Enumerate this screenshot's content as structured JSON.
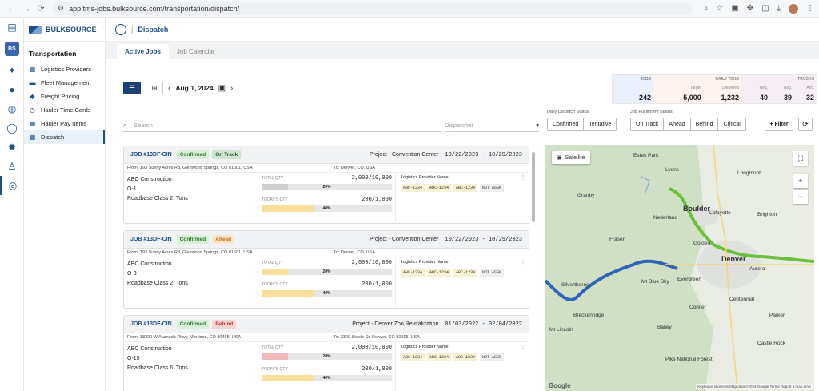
{
  "browser": {
    "url": "app.tms-jobs.bulksource.com/transportation/dispatch/"
  },
  "rail": {
    "badge": "BS"
  },
  "brand": {
    "name": "BULKSOURCE"
  },
  "nav": {
    "section": "Transportation",
    "items": [
      {
        "label": "Logistics Providers"
      },
      {
        "label": "Fleet Management"
      },
      {
        "label": "Freight Pricing"
      },
      {
        "label": "Hauler Time Cards"
      },
      {
        "label": "Hauler Pay Items"
      },
      {
        "label": "Dispatch"
      }
    ]
  },
  "page": {
    "title": "Dispatch"
  },
  "tabs": [
    {
      "label": "Active Jobs"
    },
    {
      "label": "Job Calendar"
    }
  ],
  "toolbar": {
    "date": "Aug 1, 2024"
  },
  "kpi": {
    "jobs_label": "JOBS",
    "jobs": "242",
    "tons_label": "DAILY TONS",
    "target_label": "Target",
    "target": "5,000",
    "delivered_label": "Delivered",
    "delivered": "1,232",
    "trucks_label": "TRUCKS",
    "req_label": "Req.",
    "req": "40",
    "asg_label": "Asg.",
    "asg": "39",
    "acc_label": "Acc.",
    "acc": "32"
  },
  "filters": {
    "search_placeholder": "Search",
    "dispatcher_placeholder": "Dispatcher",
    "daily_label": "Daily Dispatch Status",
    "daily": [
      "Confirmed",
      "Tentative"
    ],
    "fulfill_label": "Job Fulfillment Status",
    "fulfill": [
      "On Track",
      "Ahead",
      "Behind",
      "Critical"
    ],
    "filter_label": "+ Filter"
  },
  "jobs": [
    {
      "id": "JOB #13DF-CIN",
      "status": "Confirmed",
      "track": "On Track",
      "project": "Project - Convention Center",
      "dates": "10/22/2023 - 10/29/2023",
      "from": "From: 193 Sunny Acres Rd, Glenwood Springs, CO 81601, USA",
      "to": "To: Denver, CO, USA",
      "customer": "ABC Construction",
      "order": "O-1",
      "material": "Roadbase Class 2, Tons",
      "total_label": "TOTAL QTY",
      "total": "2,000/10,000",
      "total_pct": "20%",
      "today_label": "TODAY'S QTY",
      "today": "200/1,000",
      "today_pct": "40%",
      "lp_label": "Logistics Provider Name",
      "tags": [
        "ABC-1234",
        "ABC-1234",
        "ABC-1234",
        "NOT ASGN"
      ]
    },
    {
      "id": "JOB #13DF-CIN",
      "status": "Confirmed",
      "track": "Ahead",
      "project": "Project - Convention Center",
      "dates": "10/22/2023 - 10/29/2023",
      "from": "From: 193 Sunny Acres Rd, Glenwood Springs, CO 81601, USA",
      "to": "To: Denver, CO, USA",
      "customer": "ABC Construction",
      "order": "O-3",
      "material": "Roadbase Class 2, Tons",
      "total_label": "TOTAL QTY",
      "total": "2,000/10,000",
      "total_pct": "20%",
      "today_label": "TODAY'S QTY",
      "today": "200/1,000",
      "today_pct": "40%",
      "lp_label": "Logistics Provider Name",
      "tags": [
        "ABC-1234",
        "ABC-1234",
        "ABC-1234",
        "NOT ASGN"
      ]
    },
    {
      "id": "JOB #13DF-CIN",
      "status": "Confirmed",
      "track": "Behind",
      "project": "Project - Denver Zoo Revitalization",
      "dates": "01/03/2022 - 02/04/2022",
      "from": "From: 18300 W Alameda Pkwy, Morrison, CO 80465, USA",
      "to": "To: 2300 Steele St, Denver, CO 80205, USA",
      "customer": "ABC Construction",
      "order": "O-15",
      "material": "Roadbase Class 6, Tons",
      "total_label": "TOTAL QTY",
      "total": "2,000/10,000",
      "total_pct": "20%",
      "today_label": "TODAY'S QTY",
      "today": "200/1,000",
      "today_pct": "40%",
      "lp_label": "Logistics Provider Name",
      "tags": [
        "ABC-1234",
        "ABC-1234",
        "ABC-1234",
        "NOT ASGN"
      ]
    }
  ],
  "map": {
    "satellite": "Satellite",
    "labels": {
      "boulder": "Boulder",
      "denver": "Denver",
      "aurora": "Aurora",
      "evergreen": "Evergreen",
      "silverthorne": "Silverthorne",
      "breckenridge": "Breckenridge",
      "mtblue": "Mt Blue Sky",
      "nederland": "Nederland",
      "lafayette": "Lafayette",
      "brighton": "Brighton",
      "golden": "Golden",
      "centennial": "Centennial",
      "castle": "Castle Rock",
      "parker": "Parker",
      "estes": "Estes Park",
      "granby": "Granby",
      "fraser": "Fraser",
      "lyons": "Lyons",
      "longmont": "Longmont",
      "bailey": "Bailey",
      "conifer": "Conifer",
      "lincoln": "Mt Lincoln",
      "pike": "Pike National Forest"
    },
    "footer": "Keyboard shortcuts   Map data ©2024 Google   Terms   Report a map error",
    "google": "Google"
  }
}
